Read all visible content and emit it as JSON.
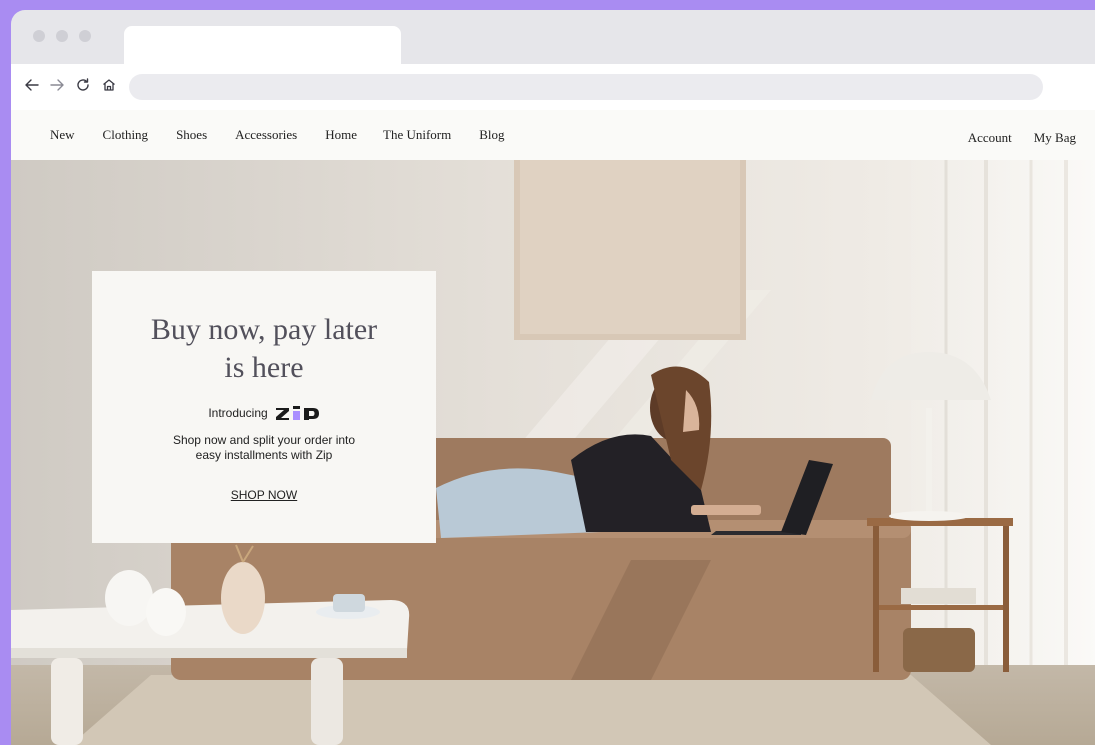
{
  "browser": {
    "tab_title": "",
    "url": "",
    "nav_icons": {
      "back": "arrow-left",
      "forward": "arrow-right",
      "reload": "reload",
      "home": "home"
    }
  },
  "site_nav": {
    "links": [
      {
        "label": "New"
      },
      {
        "label": "Clothing"
      },
      {
        "label": "Shoes"
      },
      {
        "label": "Accessories"
      },
      {
        "label": "Home"
      },
      {
        "label": "The Uniform"
      },
      {
        "label": "Blog"
      }
    ],
    "account_label": "Account",
    "bag_label": "My Bag"
  },
  "promo": {
    "heading_line1": "Buy now, pay later",
    "heading_line2": "is here",
    "intro_label": "Introducing",
    "brand_logo": "Zip",
    "description_line1": "Shop now and split your order into",
    "description_line2": "easy installments with Zip",
    "cta_label": "SHOP NOW"
  },
  "colors": {
    "backdrop": "#a98cf2",
    "brand_accent": "#aa8fff",
    "heading_text": "#52505b"
  }
}
